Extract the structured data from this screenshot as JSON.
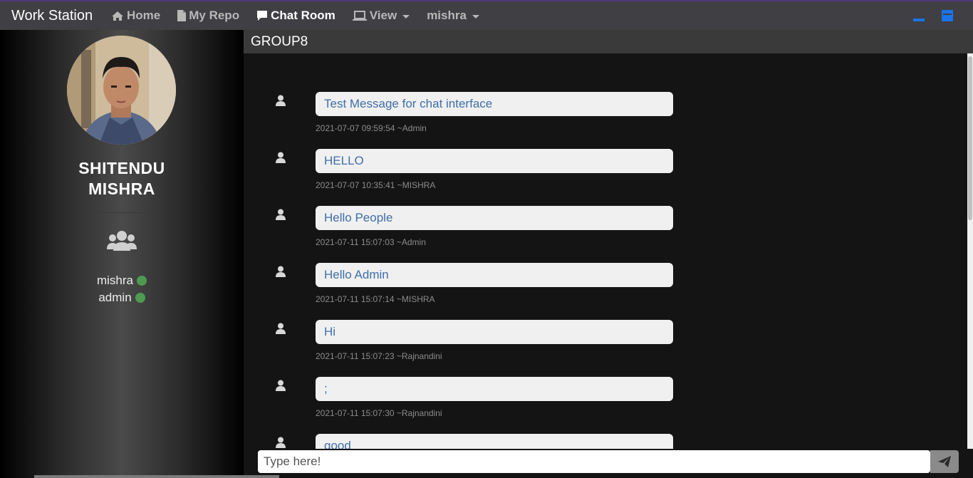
{
  "navbar": {
    "brand": "Work Station",
    "items": [
      {
        "label": "Home",
        "icon": "home-icon"
      },
      {
        "label": "My Repo",
        "icon": "file-icon"
      },
      {
        "label": "Chat Room",
        "icon": "chat-icon"
      },
      {
        "label": "View",
        "icon": "laptop-icon"
      },
      {
        "label": "mishra"
      }
    ],
    "accent": "#1a73e8"
  },
  "sidebar": {
    "name_line1": "SHITENDU",
    "name_line2": "MISHRA",
    "members": [
      {
        "name": "mishra",
        "status": "online"
      },
      {
        "name": "admin",
        "status": "online"
      }
    ],
    "online_color": "#4e9a50"
  },
  "chat": {
    "group_name": "GROUP8",
    "messages": [
      {
        "text": "Test Message for chat interface",
        "meta": "2021-07-07 09:59:54 ~Admin"
      },
      {
        "text": "HELLO",
        "meta": "2021-07-07 10:35:41 ~MISHRA"
      },
      {
        "text": "Hello People",
        "meta": "2021-07-11 15:07:03 ~Admin"
      },
      {
        "text": "Hello Admin",
        "meta": "2021-07-11 15:07:14 ~MISHRA"
      },
      {
        "text": "Hi",
        "meta": "2021-07-11 15:07:23 ~Rajnandini"
      },
      {
        "text": ";",
        "meta": "2021-07-11 15:07:30 ~Rajnandini"
      },
      {
        "text": "good",
        "meta": ""
      }
    ],
    "input_placeholder": "Type here!"
  }
}
